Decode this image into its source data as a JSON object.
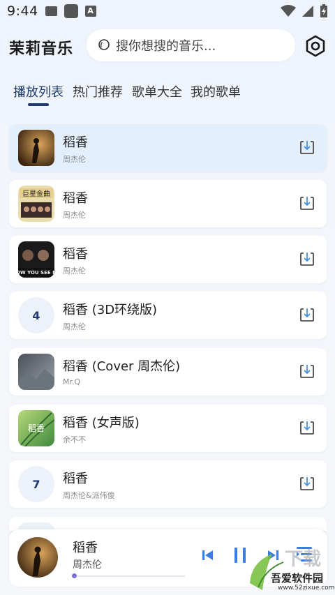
{
  "status_bar": {
    "time": "9:44",
    "notif_a": "A"
  },
  "header": {
    "app_title": "茉莉音乐",
    "search_placeholder": "搜你想搜的音乐..."
  },
  "tabs": [
    {
      "label": "播放列表",
      "active": true
    },
    {
      "label": "热门推荐",
      "active": false
    },
    {
      "label": "歌单大全",
      "active": false
    },
    {
      "label": "我的歌单",
      "active": false
    }
  ],
  "songs": [
    {
      "title": "稻香",
      "artist": "周杰伦",
      "cover": "image",
      "active": true
    },
    {
      "title": "稻香",
      "artist": "周杰伦",
      "cover": "image",
      "active": false
    },
    {
      "title": "稻香",
      "artist": "周杰伦",
      "cover": "image",
      "active": false
    },
    {
      "title": "稻香 (3D环绕版)",
      "artist": "周杰伦",
      "cover_number": "4",
      "active": false
    },
    {
      "title": "稻香 (Cover 周杰伦)",
      "artist": "Mr.Q",
      "cover": "image",
      "active": false
    },
    {
      "title": "稻香 (女声版)",
      "artist": "余不不",
      "cover": "image",
      "active": false
    },
    {
      "title": "稻香",
      "artist": "周杰伦&派伟俊",
      "cover_number": "7",
      "active": false
    }
  ],
  "player": {
    "title": "稻香",
    "artist": "周杰伦",
    "progress": 0.02
  },
  "watermark": {
    "name": "吾爱软件园",
    "url": "www.52zixue.com"
  },
  "colors": {
    "accent": "#1e3a6e",
    "active_row": "#e3effd",
    "download_arrow": "#4a90e2"
  }
}
